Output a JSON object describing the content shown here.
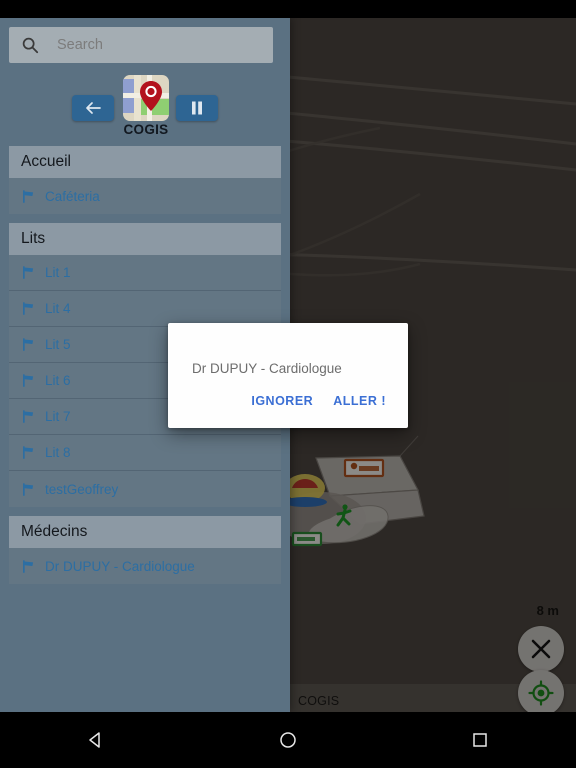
{
  "app": {
    "brand_name": "COGIS",
    "map_attribution": "COGIS"
  },
  "search": {
    "placeholder": "Search",
    "value": "",
    "icon": "search-icon"
  },
  "toolbar": {
    "back_icon": "arrow-left-icon",
    "maps_icon": "map-book-icon",
    "logo_icon": "map-pin-logo-icon"
  },
  "sidebar": {
    "sections": [
      {
        "title": "Accueil",
        "items": [
          {
            "label": "Caféteria",
            "icon": "flag-icon"
          }
        ]
      },
      {
        "title": "Lits",
        "items": [
          {
            "label": "Lit 1",
            "icon": "flag-icon"
          },
          {
            "label": "Lit 4",
            "icon": "flag-icon"
          },
          {
            "label": "Lit 5",
            "icon": "flag-icon"
          },
          {
            "label": "Lit 6",
            "icon": "flag-icon"
          },
          {
            "label": "Lit 7",
            "icon": "flag-icon"
          },
          {
            "label": "Lit 8",
            "icon": "flag-icon"
          },
          {
            "label": "testGeoffrey",
            "icon": "flag-icon"
          }
        ]
      },
      {
        "title": "Médecins",
        "items": [
          {
            "label": "Dr DUPUY - Cardiologue",
            "icon": "flag-icon"
          }
        ]
      }
    ]
  },
  "dialog": {
    "message": "Dr DUPUY - Cardiologue",
    "dismiss_label": "IGNORER",
    "confirm_label": "ALLER !"
  },
  "map": {
    "scale_label": "8 m",
    "close_icon": "close-x-icon",
    "locate_icon": "my-location-icon"
  },
  "system_nav": {
    "back_icon": "triangle-back-icon",
    "home_icon": "circle-home-icon",
    "recents_icon": "square-recents-icon"
  },
  "colors": {
    "drawer_bg": "#5b7182",
    "accent_blue": "#2c6ea3",
    "button_blue": "#2e6593",
    "dialog_link": "#3b6fd4",
    "map_bg": "#514a44",
    "locate_green": "#1f8f1f"
  }
}
